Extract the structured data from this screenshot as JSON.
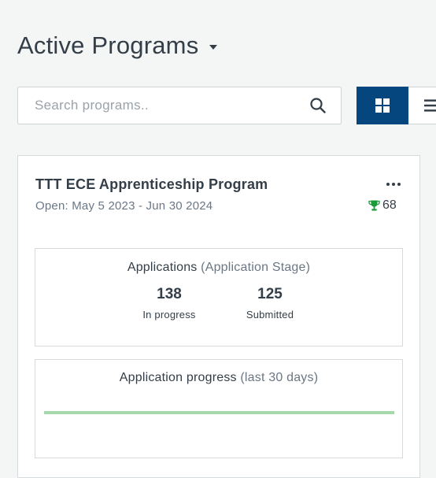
{
  "header": {
    "title": "Active Programs"
  },
  "search": {
    "placeholder": "Search programs.."
  },
  "view_toggle": {
    "active": "grid",
    "accent": "#05467e"
  },
  "program": {
    "title": "TTT ECE Apprenticeship Program",
    "dates": "Open: May 5 2023 - Jun 30 2024",
    "awards": "68",
    "trophy_color": "#1a9a38",
    "applications": {
      "label": "Applications",
      "stage": "(Application Stage)",
      "in_progress_count": "138",
      "in_progress_label": "In progress",
      "submitted_count": "125",
      "submitted_label": "Submitted"
    },
    "progress": {
      "label": "Application progress",
      "range": "(last 30 days)",
      "line_color": "#a6d8ab"
    }
  }
}
